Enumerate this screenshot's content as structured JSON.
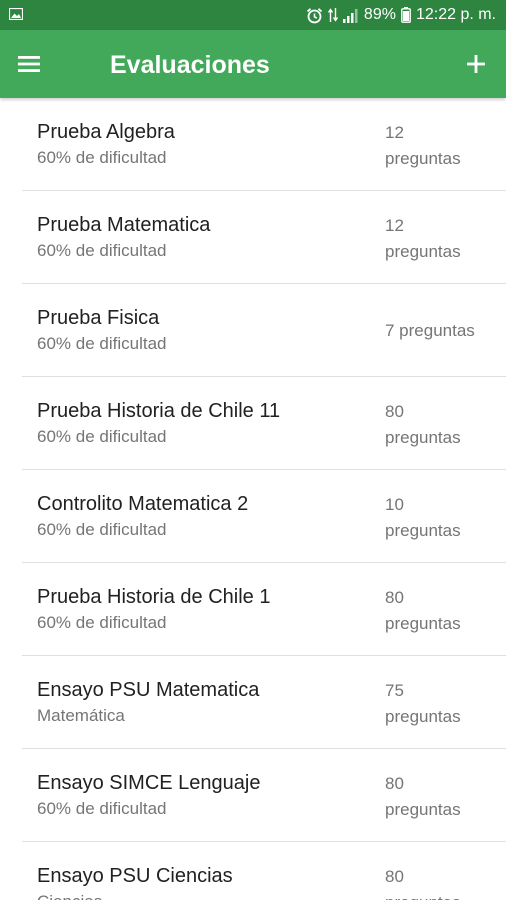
{
  "status_bar": {
    "left_icon": "image-notification-icon",
    "icons": [
      "alarm-icon",
      "data-signal-icon",
      "cell-signal-icon",
      "battery-icon"
    ],
    "battery": "89%",
    "time": "12:22 p. m."
  },
  "app_bar": {
    "title": "Evaluaciones",
    "menu_icon": "hamburger-menu-icon",
    "add_icon": "plus-icon",
    "color": "#43a95a",
    "status_color": "#2e8540"
  },
  "items": [
    {
      "title": "Prueba Algebra",
      "subtitle": "60% de dificultad",
      "count_line1": "12",
      "count_line2": "preguntas"
    },
    {
      "title": "Prueba Matematica",
      "subtitle": "60% de dificultad",
      "count_line1": "12",
      "count_line2": "preguntas"
    },
    {
      "title": "Prueba Fisica",
      "subtitle": "60% de dificultad",
      "count_line1": "7 preguntas",
      "count_line2": ""
    },
    {
      "title": "Prueba Historia de Chile 11",
      "subtitle": "60% de dificultad",
      "count_line1": "80",
      "count_line2": "preguntas"
    },
    {
      "title": "Controlito Matematica 2",
      "subtitle": "60% de dificultad",
      "count_line1": "10",
      "count_line2": "preguntas"
    },
    {
      "title": "Prueba Historia de Chile 1",
      "subtitle": "60% de dificultad",
      "count_line1": "80",
      "count_line2": "preguntas"
    },
    {
      "title": "Ensayo PSU Matematica",
      "subtitle": "Matemática",
      "count_line1": "75",
      "count_line2": "preguntas"
    },
    {
      "title": "Ensayo SIMCE Lenguaje",
      "subtitle": "60% de dificultad",
      "count_line1": "80",
      "count_line2": "preguntas"
    },
    {
      "title": "Ensayo PSU Ciencias",
      "subtitle": "Ciencias",
      "count_line1": "80",
      "count_line2": "preguntas"
    }
  ]
}
